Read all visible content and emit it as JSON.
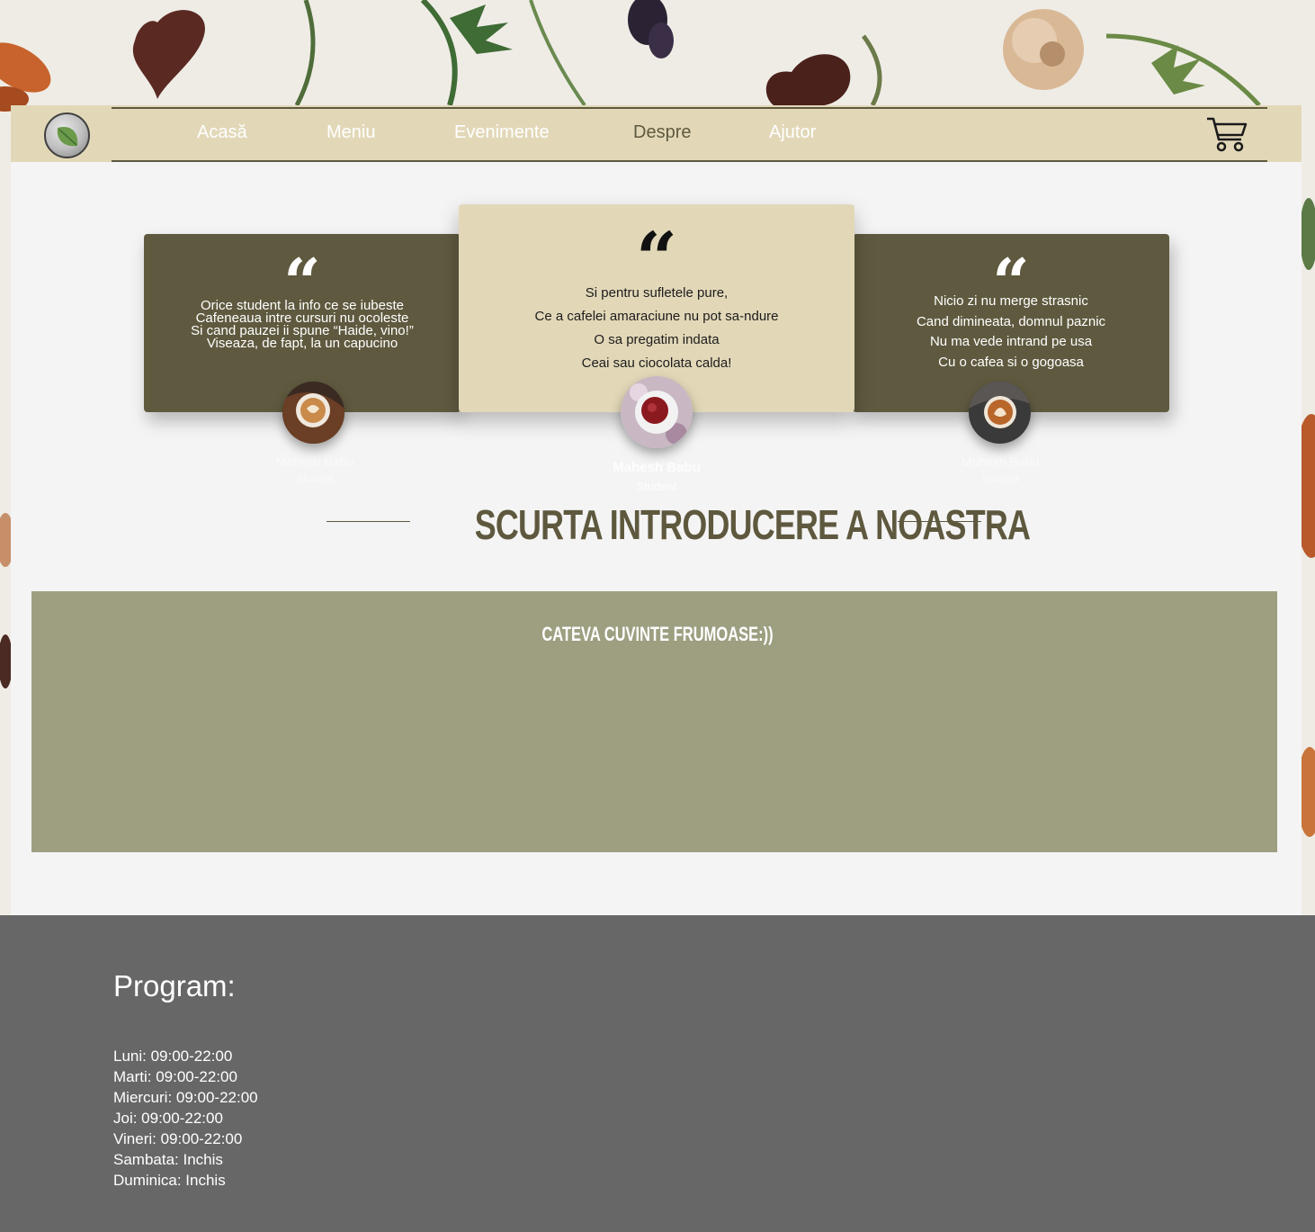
{
  "nav": {
    "items": [
      {
        "label": "Acasă"
      },
      {
        "label": "Meniu"
      },
      {
        "label": "Evenimente"
      },
      {
        "label": "Despre",
        "active": true
      },
      {
        "label": "Ajutor"
      }
    ]
  },
  "testimonials": [
    {
      "lines": [
        "Orice student la info ce se iubeste",
        "Cafeneaua intre cursuri nu ocoleste",
        "Si cand pauzei ii spune “Haide, vino!”",
        "Viseaza, de fapt, la un capucino"
      ],
      "name": "Mahesh Babu",
      "role": "Student"
    },
    {
      "lines": [
        "Si pentru sufletele pure,",
        "Ce a cafelei amaraciune nu pot sa-ndure",
        "O sa pregatim indata",
        "Ceai sau ciocolata calda!"
      ],
      "name": "Mahesh Babu",
      "role": "Student"
    },
    {
      "lines": [
        "Nicio zi nu merge strasnic",
        "Cand dimineata, domnul paznic",
        "Nu ma vede intrand pe usa",
        "Cu o cafea si o gogoasa"
      ],
      "name": "Mahesh Babu",
      "role": "Student"
    }
  ],
  "section": {
    "title": "SCURTA INTRODUCERE A NOASTRA",
    "box_heading": "CATEVA CUVINTE FRUMOASE:))"
  },
  "footer": {
    "title": "Program:",
    "hours": [
      "Luni: 09:00-22:00",
      "Marti: 09:00-22:00",
      "Miercuri: 09:00-22:00",
      "Joi: 09:00-22:00",
      "Vineri: 09:00-22:00",
      "Sambata: Inchis",
      "Duminica: Inchis"
    ]
  },
  "colors": {
    "nav_bg": "#e2d8b8",
    "accent": "#5e593e",
    "card_dark": "#5f5a3f",
    "intro_box": "#9e9f81",
    "footer_bg": "#676767"
  }
}
